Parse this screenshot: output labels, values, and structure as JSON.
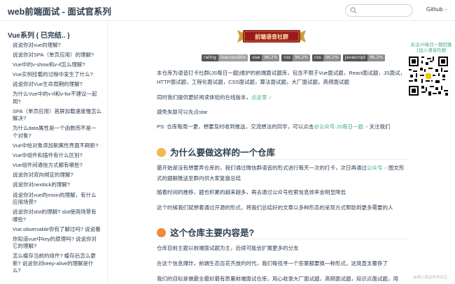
{
  "navbar": {
    "title": "web前端面试 - 面试官系列",
    "search_placeholder": "",
    "github_label": "Github"
  },
  "sidebar": {
    "group_title": "Vue系列 ( 已完结.. )",
    "items": [
      "说说你对vue的理解?",
      "说说你对SPA（单页应用）的理解?",
      "Vue中的v-show和v-if怎么理解?",
      "Vue实例挂载的过程中发生了什么?",
      "说说你对Vue生命周期的理解?",
      "为什么Vue中的v-if和v-for不建议一起用?",
      "SPA（单页应用）首屏加载速度慢怎么解决?",
      "为什么data属性是一个函数而不是一个对象?",
      "Vue中给对象添加新属性界面不刷新?",
      "Vue中组件和插件有什么区别?",
      "Vue组件间通信方式都有哪些?",
      "说说你对双向绑定的理解?",
      "说说你对nexttick的理解?",
      "说说你对vue的mixin的理解，有什么应用场景?",
      "说说你对slot的理解? slot使用场景有哪些?",
      "Vue.observable你有了解过吗? 说说看",
      "你知道vue中key的原理吗? 说说你对它的理解?",
      "怎么缓存当前的组件? 缓存后怎么更新? 说说你对keep-alive的理解是什么?"
    ]
  },
  "content": {
    "banner_text": "前端语音社群",
    "badges": [
      {
        "label": "rating",
        "value": "inaccessible"
      },
      {
        "label": "vue",
        "value": "96.2%"
      },
      {
        "label": "css",
        "value": "96.2%"
      },
      {
        "label": "css",
        "value": "96.2%"
      },
      {
        "label": "javascript",
        "value": "96.2%"
      }
    ],
    "intro": "本仓库为语音打卡社群(JS每日一题)维护的前端面试题库，包含不限于Vue面试题，React面试题，JS面试，HTTP面试题，工程化面试题，CSS面试题，算法面试题，大厂面试题，高频面试题",
    "online_prefix": "同时我们提供更好阅读体验的在线版本，",
    "online_link": "点这里",
    "star_line": "避免失联可以先点star",
    "ps_prefix": "PS: 仓库每周一更，想要及时收到推送，交流想法的同学，可以点击",
    "ps_link": "@公众号:JS每日一题",
    "ps_suffix": "关注我们",
    "h2_1": "为什么要做这样的一个仓库",
    "p1_prefix": "最开始是没有想要弄仓库的，我们通过微信群语音的形式进行每天一次的打卡，次日再通过",
    "p1_link": "公众号",
    "p1_suffix": "图文形式的题解推送至群内供大家复盘总结",
    "p2": "随着时间的推移，题也积累的越来越多，再去通过公众号检索信息效率会明显降低",
    "p3": "这个时候我们就想着通过开源的形式，将我们总结好的文章以多种形态的呈现方式帮助到更多需要的人",
    "h2_2": "这个仓库主要内容是?",
    "p4": "仓库目前主题以前端面试题为主，后续可能会扩展更多的分支",
    "p5": "在这个信息爆炸，前端生态百花齐放的时代，我们每找寻一个答案都要换一种形式，这简直太奢侈了",
    "p6": "我们的目标是做最全最好最有质量前端面试仓库，用心收录大厂面试题，高频面试题，知识点面试题，用",
    "qr_caption": "关注JS每日一题回复1加入语音社群",
    "watermark": "@稀土掘金技术社区"
  },
  "colors": {
    "accent": "#3eaf7c",
    "text": "#2c3e50",
    "banner_red": "#9b1b1b",
    "badge_left": "#555555",
    "badge_right": "#8e8e8e"
  }
}
